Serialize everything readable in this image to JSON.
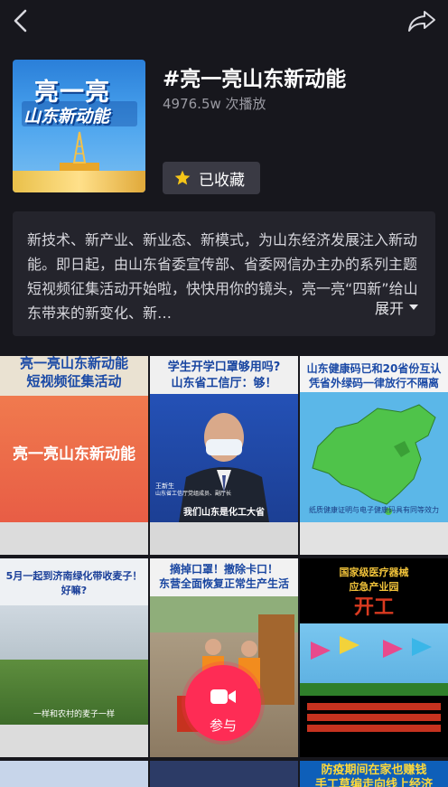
{
  "topbar": {
    "back_icon": "chevron-left-icon",
    "share_icon": "share-arrow-icon"
  },
  "topic": {
    "cover_line1": "亮一亮",
    "cover_line2": "山东新动能",
    "title": "#亮一亮山东新动能",
    "playcount": "4976.5w 次播放",
    "fav_label": "已收藏",
    "fav_icon": "star-icon"
  },
  "description": {
    "text": "新技术、新产业、新业态、新模式，为山东经济发展注入新动能。即日起，由山东省委宣传部、省委网信办主办的系列主题短视频征集活动开始啦，快快用你的镜头，亮一亮“四新”给山东带来的新变化、新…",
    "expand_label": "展开"
  },
  "videos": [
    {
      "line1": "亮一亮山东新动能",
      "line2": "短视频征集活动",
      "line3": "亮一亮山东新动能"
    },
    {
      "line1": "学生开学口罩够用吗?",
      "line2": "山东省工信厅：够！",
      "sub": "我们山东是化工大省",
      "name": "王新生",
      "role": "山东省工信厅党组成员、副厅长"
    },
    {
      "line1": "山东健康码已和20省份互认",
      "line2": "凭省外绿码一律放行不隔离",
      "note": "纸质健康证明与电子健康码具有同等效力"
    },
    {
      "line1": "5月一起到济南绿化带收麦子！",
      "line2": "好嘛?",
      "sub": "一样和农村的麦子一样"
    },
    {
      "line1": "摘掉口罩！撤除卡口！",
      "line2": "东营全面恢复正常生产生活"
    },
    {
      "line1": "国家级医疗器械",
      "line2": "应急产业园",
      "line3": "开工"
    },
    {
      "line1": ""
    },
    {
      "line1": ""
    },
    {
      "line1": "防疫期间在家也赚钱",
      "line2": "手工草编走向线上经济"
    }
  ],
  "join": {
    "label": "参与",
    "icon": "video-camera-icon",
    "color": "#fe2c55"
  },
  "colors": {
    "background": "#17171d",
    "accent": "#fe2c55",
    "star": "#f5c518"
  }
}
